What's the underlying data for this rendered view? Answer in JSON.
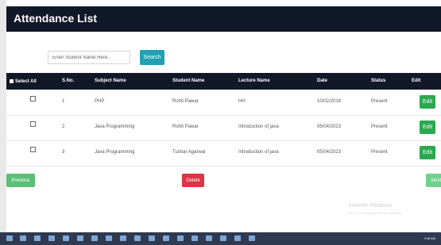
{
  "header": {
    "title": "Attendance List"
  },
  "search": {
    "placeholder": "Enter Student Name Here..",
    "button": "Search"
  },
  "table": {
    "columns": [
      "Select All",
      "S.No.",
      "Subject Name",
      "Student Name",
      "Lecture Name",
      "Date",
      "Status",
      "Edit"
    ],
    "rows": [
      {
        "sno": "1",
        "subject": "PHP",
        "student": "Rohit Pawar",
        "lecture": "HH",
        "date": "10/02/2018",
        "status": "Present",
        "edit": "Edit"
      },
      {
        "sno": "2",
        "subject": "Java Programming",
        "student": "Rohit Pawar",
        "lecture": "Introduction of java",
        "date": "05/04/2023",
        "status": "Present",
        "edit": "Edit"
      },
      {
        "sno": "3",
        "subject": "Java Programming",
        "student": "Tushar Agarwal",
        "lecture": "Introduction of java",
        "date": "05/04/2023",
        "status": "Present",
        "edit": "Edit"
      }
    ]
  },
  "buttons": {
    "previous": "Previous",
    "delete": "Delete",
    "next": "Next"
  },
  "watermark": {
    "title": "Activate Windows",
    "subtitle": "Go to PC settings to activate Windows."
  },
  "taskbar": {
    "time": "7:08 AM"
  },
  "colors": {
    "header": "#111827",
    "search": "#1fa2b3",
    "edit": "#2aa84f",
    "delete": "#dc3545",
    "nav": "#5bbf78"
  }
}
